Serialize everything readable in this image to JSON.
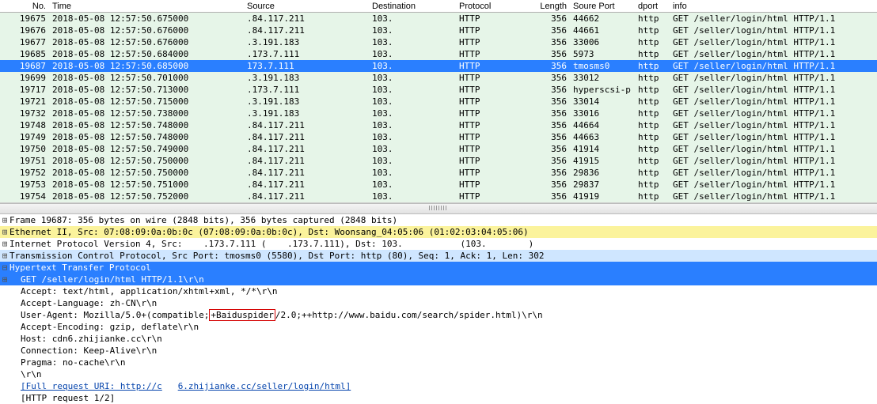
{
  "columns": {
    "no": "No.",
    "time": "Time",
    "src": "Source",
    "dst": "Destination",
    "proto": "Protocol",
    "len": "Length",
    "sport": "Soure Port",
    "dport": "dport",
    "info": "info"
  },
  "rows": [
    {
      "no": "19675",
      "time": "2018-05-08 12:57:50.675000",
      "src": ".84.117.211",
      "dst": "103.",
      "proto": "HTTP",
      "len": "356",
      "sport": "44662",
      "dport": "http",
      "info": "GET /seller/login/html HTTP/1.1"
    },
    {
      "no": "19676",
      "time": "2018-05-08 12:57:50.676000",
      "src": ".84.117.211",
      "dst": "103.",
      "proto": "HTTP",
      "len": "356",
      "sport": "44661",
      "dport": "http",
      "info": "GET /seller/login/html HTTP/1.1"
    },
    {
      "no": "19677",
      "time": "2018-05-08 12:57:50.676000",
      "src": ".3.191.183",
      "dst": "103.",
      "proto": "HTTP",
      "len": "356",
      "sport": "33006",
      "dport": "http",
      "info": "GET /seller/login/html HTTP/1.1"
    },
    {
      "no": "19685",
      "time": "2018-05-08 12:57:50.684000",
      "src": ".173.7.111",
      "dst": "103.",
      "proto": "HTTP",
      "len": "356",
      "sport": "5973",
      "dport": "http",
      "info": "GET /seller/login/html HTTP/1.1"
    },
    {
      "no": "19687",
      "time": "2018-05-08 12:57:50.685000",
      "src": "173.7.111",
      "dst": "103.",
      "proto": "HTTP",
      "len": "356",
      "sport": "tmosms0",
      "dport": "http",
      "info": "GET /seller/login/html HTTP/1.1",
      "selected": true
    },
    {
      "no": "19699",
      "time": "2018-05-08 12:57:50.701000",
      "src": ".3.191.183",
      "dst": "103.",
      "proto": "HTTP",
      "len": "356",
      "sport": "33012",
      "dport": "http",
      "info": "GET /seller/login/html HTTP/1.1"
    },
    {
      "no": "19717",
      "time": "2018-05-08 12:57:50.713000",
      "src": ".173.7.111",
      "dst": "103.",
      "proto": "HTTP",
      "len": "356",
      "sport": "hyperscsi-p",
      "dport": "http",
      "info": "GET /seller/login/html HTTP/1.1"
    },
    {
      "no": "19721",
      "time": "2018-05-08 12:57:50.715000",
      "src": ".3.191.183",
      "dst": "103.",
      "proto": "HTTP",
      "len": "356",
      "sport": "33014",
      "dport": "http",
      "info": "GET /seller/login/html HTTP/1.1"
    },
    {
      "no": "19732",
      "time": "2018-05-08 12:57:50.738000",
      "src": ".3.191.183",
      "dst": "103.",
      "proto": "HTTP",
      "len": "356",
      "sport": "33016",
      "dport": "http",
      "info": "GET /seller/login/html HTTP/1.1"
    },
    {
      "no": "19748",
      "time": "2018-05-08 12:57:50.748000",
      "src": ".84.117.211",
      "dst": "103.",
      "proto": "HTTP",
      "len": "356",
      "sport": "44664",
      "dport": "http",
      "info": "GET /seller/login/html HTTP/1.1"
    },
    {
      "no": "19749",
      "time": "2018-05-08 12:57:50.748000",
      "src": ".84.117.211",
      "dst": "103.",
      "proto": "HTTP",
      "len": "356",
      "sport": "44663",
      "dport": "http",
      "info": "GET /seller/login/html HTTP/1.1"
    },
    {
      "no": "19750",
      "time": "2018-05-08 12:57:50.749000",
      "src": ".84.117.211",
      "dst": "103.",
      "proto": "HTTP",
      "len": "356",
      "sport": "41914",
      "dport": "http",
      "info": "GET /seller/login/html HTTP/1.1"
    },
    {
      "no": "19751",
      "time": "2018-05-08 12:57:50.750000",
      "src": ".84.117.211",
      "dst": "103.",
      "proto": "HTTP",
      "len": "356",
      "sport": "41915",
      "dport": "http",
      "info": "GET /seller/login/html HTTP/1.1"
    },
    {
      "no": "19752",
      "time": "2018-05-08 12:57:50.750000",
      "src": ".84.117.211",
      "dst": "103.",
      "proto": "HTTP",
      "len": "356",
      "sport": "29836",
      "dport": "http",
      "info": "GET /seller/login/html HTTP/1.1"
    },
    {
      "no": "19753",
      "time": "2018-05-08 12:57:50.751000",
      "src": ".84.117.211",
      "dst": "103.",
      "proto": "HTTP",
      "len": "356",
      "sport": "29837",
      "dport": "http",
      "info": "GET /seller/login/html HTTP/1.1"
    },
    {
      "no": "19754",
      "time": "2018-05-08 12:57:50.752000",
      "src": ".84.117.211",
      "dst": "103.",
      "proto": "HTTP",
      "len": "356",
      "sport": "41919",
      "dport": "http",
      "info": "GET /seller/login/html HTTP/1.1"
    }
  ],
  "details": {
    "frame": "Frame 19687: 356 bytes on wire (2848 bits), 356 bytes captured (2848 bits)",
    "eth": "Ethernet II, Src: 07:08:09:0a:0b:0c (07:08:09:0a:0b:0c), Dst: Woonsang_04:05:06 (01:02:03:04:05:06)",
    "ip": "Internet Protocol Version 4, Src:    .173.7.111 (    .173.7.111), Dst: 103.           (103.        )",
    "tcp": "Transmission Control Protocol, Src Port: tmosms0 (5580), Dst Port: http (80), Seq: 1, Ack: 1, Len: 302",
    "http_header": "Hypertext Transfer Protocol",
    "http_req": "GET /seller/login/html HTTP/1.1\\r\\n",
    "accept": "Accept: text/html, application/xhtml+xml, */*\\r\\n",
    "accept_lang": "Accept-Language: zh-CN\\r\\n",
    "ua_pre": "User-Agent: Mozilla/5.0+(compatible;",
    "ua_mark": "+Baiduspider",
    "ua_post": "/2.0;++http://www.baidu.com/search/spider.html)\\r\\n",
    "accept_enc": "Accept-Encoding: gzip, deflate\\r\\n",
    "host": "Host: cdn6.zhijianke.cc\\r\\n",
    "conn": "Connection: Keep-Alive\\r\\n",
    "pragma": "Pragma: no-cache\\r\\n",
    "crlf": "\\r\\n",
    "full_uri_a": "[Full request URI: http://c",
    "full_uri_b": "6.zhijianke.cc/seller/login/html]",
    "req12": "[HTTP request 1/2]"
  }
}
